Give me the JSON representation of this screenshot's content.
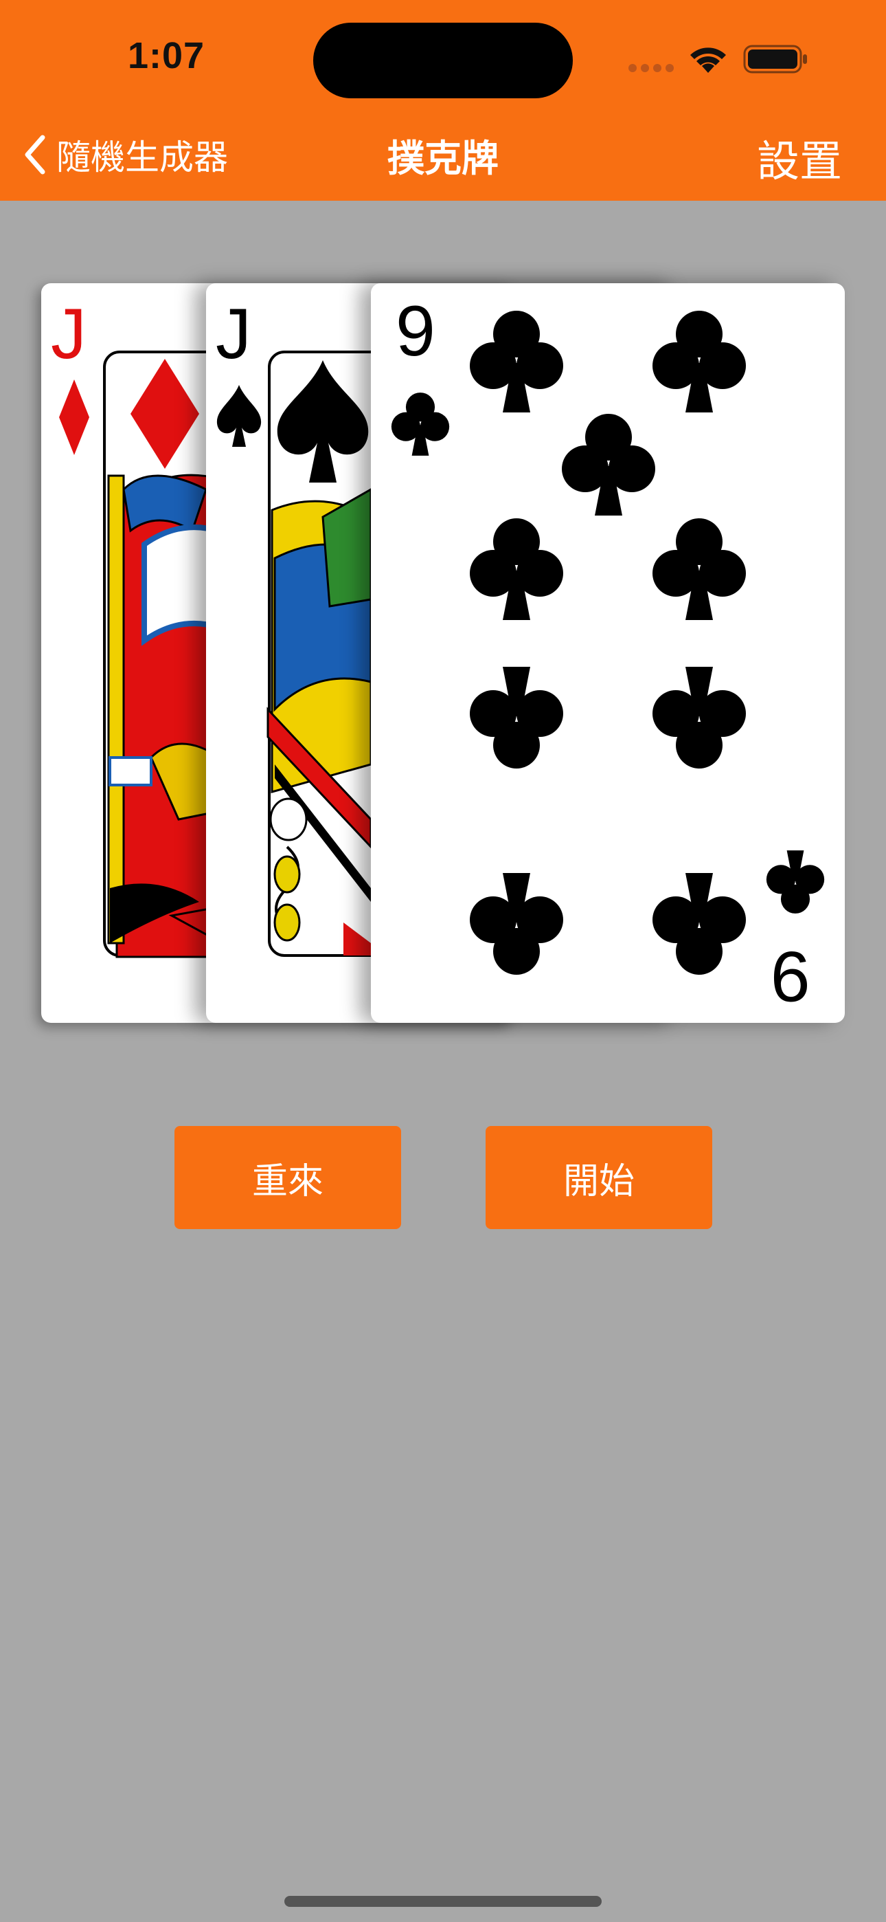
{
  "status_bar": {
    "time": "1:07"
  },
  "nav": {
    "back_label": "隨機生成器",
    "title": "撲克牌",
    "settings_label": "設置"
  },
  "cards": [
    {
      "rank": "J",
      "suit": "diamonds",
      "color": "#e01010"
    },
    {
      "rank": "J",
      "suit": "spades",
      "color": "#000000"
    },
    {
      "rank": "9",
      "suit": "clubs",
      "color": "#000000"
    }
  ],
  "buttons": {
    "reset_label": "重來",
    "start_label": "開始"
  },
  "colors": {
    "accent": "#f86f12",
    "background": "#a8a8a8"
  }
}
